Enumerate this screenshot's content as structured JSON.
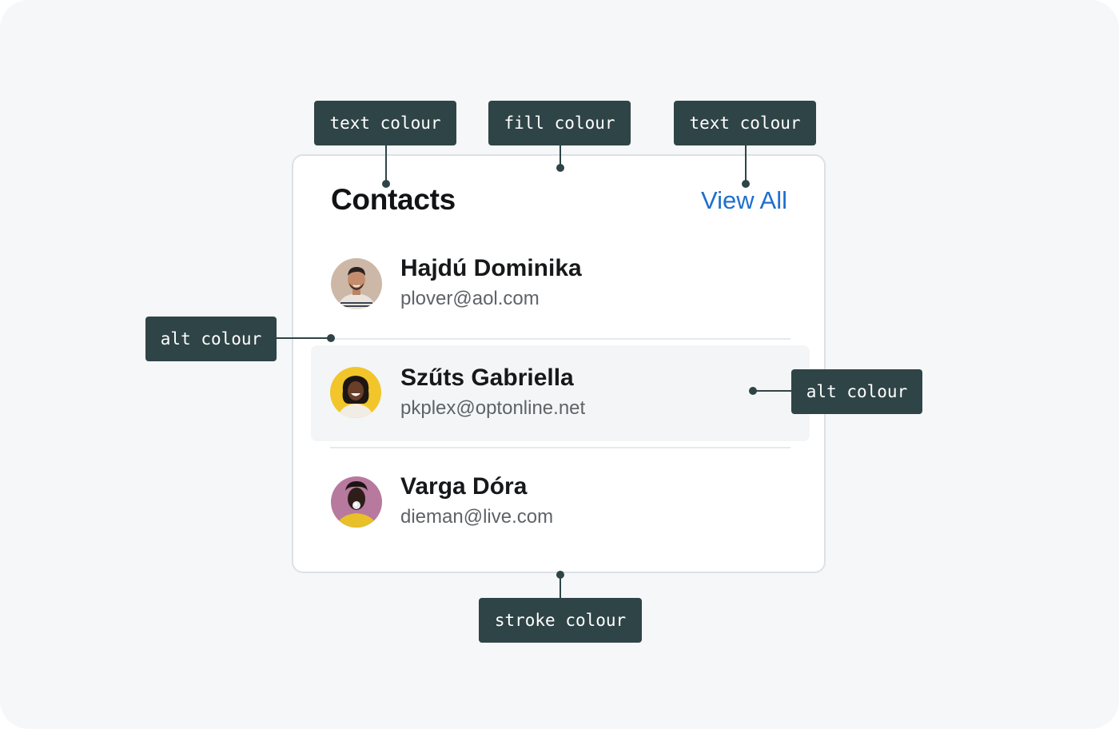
{
  "card": {
    "title": "Contacts",
    "view_all": "View All"
  },
  "contacts": [
    {
      "name": "Hajdú Dominika",
      "email": "plover@aol.com"
    },
    {
      "name": "Szűts Gabriella",
      "email": "pkplex@optonline.net"
    },
    {
      "name": "Varga Dóra",
      "email": "dieman@live.com"
    }
  ],
  "annotations": {
    "title_text": "text colour",
    "card_fill": "fill colour",
    "link_text": "text colour",
    "divider_alt": "alt colour",
    "row_alt": "alt colour",
    "card_stroke": "stroke colour"
  },
  "colors": {
    "background": "#f5f7f9",
    "card_fill": "#ffffff",
    "card_stroke": "#dde1e4",
    "alt": "#f3f5f7",
    "link": "#1f6fce",
    "tag": "#2f4446"
  }
}
